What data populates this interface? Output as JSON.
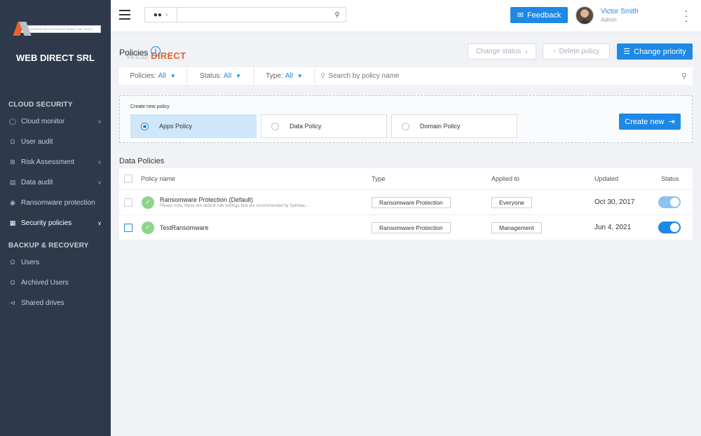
{
  "sidebar": {
    "logo_web": "WEB",
    "logo_direct": "DIRECT",
    "logo_tagline": "BUSINESS RELATIONSHIP BASED ON TRUST",
    "company": "WEB DIRECT SRL",
    "section_cloud": "CLOUD SECURITY",
    "section_backup": "BACKUP & RECOVERY",
    "items": [
      {
        "label": "Cloud monitor",
        "icon": "globe-icon"
      },
      {
        "label": "User audit",
        "icon": "user-icon"
      },
      {
        "label": "Risk Assessment",
        "icon": "grid-icon"
      },
      {
        "label": "Data audit",
        "icon": "document-icon"
      },
      {
        "label": "Ransomware protection",
        "icon": "shield-icon"
      },
      {
        "label": "Security policies",
        "icon": "policy-icon"
      },
      {
        "label": "Users",
        "icon": "users-icon"
      },
      {
        "label": "Archived Users",
        "icon": "archived-users-icon"
      },
      {
        "label": "Shared drives",
        "icon": "share-icon"
      }
    ]
  },
  "topbar": {
    "search_value": "",
    "feedback_label": "Feedback",
    "user_name": "Victor Smith",
    "user_role": "Admin"
  },
  "page": {
    "title": "Policies",
    "change_status": "Change status",
    "delete_policy": "Delete policy",
    "change_priority": "Change priority"
  },
  "filters": {
    "policies_label": "Policies:",
    "policies_value": "All",
    "status_label": "Status:",
    "status_value": "All",
    "type_label": "Type:",
    "type_value": "All",
    "search_placeholder": "Search by policy name"
  },
  "create": {
    "label": "Create new policy",
    "options": [
      "Apps Policy",
      "Data Policy",
      "Domain Policy"
    ],
    "selected": "Apps Policy",
    "button": "Create new"
  },
  "table": {
    "heading": "Data Policies",
    "columns": {
      "name": "Policy name",
      "type": "Type",
      "applied": "Applied to",
      "updated": "Updated",
      "status": "Status"
    },
    "rows": [
      {
        "name": "Ransomware Protection (Default)",
        "subtitle": "Please note, these are default rule settings that are recommended by Spinbac...",
        "type": "Ransomware Protection",
        "applied": "Everyone",
        "updated": "Oct 30, 2017",
        "enabled": true
      },
      {
        "name": "TestRansomware",
        "subtitle": "",
        "type": "Ransomware Protection",
        "applied": "Management",
        "updated": "Jun 4, 2021",
        "enabled": true
      }
    ]
  },
  "colors": {
    "accent": "#1e88e5",
    "sidebar_bg": "#2e3a4b",
    "selected_card": "#cfe6fb",
    "logo_orange": "#e8632b"
  }
}
